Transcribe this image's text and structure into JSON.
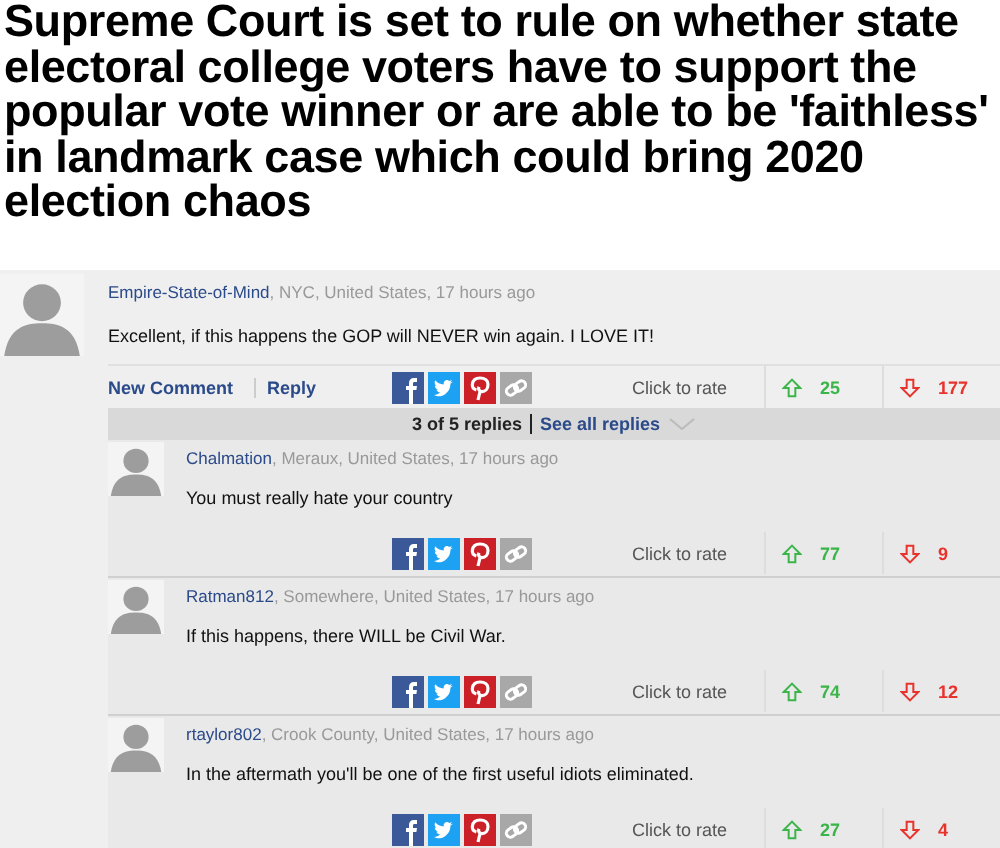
{
  "headline": "Supreme Court is set to rule on whether state electoral college voters have to support the popular vote winner or are able to be 'faithless' in landmark case which could bring 2020 election chaos",
  "comment": {
    "author": "Empire-State-of-Mind",
    "meta": ", NYC, United States, 17 hours ago",
    "body": "Excellent, if this happens the GOP will NEVER win again. I LOVE IT!",
    "actions": [
      "New Comment",
      "Reply"
    ],
    "rate_label": "Click to rate",
    "up": "25",
    "down": "177"
  },
  "replies_bar": {
    "count": "3 of 5 replies",
    "link": "See all replies"
  },
  "replies": [
    {
      "author": "Chalmation",
      "meta": ", Meraux, United States, 17 hours ago",
      "body": "You must really hate your country",
      "rate_label": "Click to rate",
      "up": "77",
      "down": "9"
    },
    {
      "author": "Ratman812",
      "meta": ", Somewhere, United States, 17 hours ago",
      "body": "If this happens, there WILL be Civil War.",
      "rate_label": "Click to rate",
      "up": "74",
      "down": "12"
    },
    {
      "author": "rtaylor802",
      "meta": ", Crook County, United States, 17 hours ago",
      "body": "In the aftermath you'll be one of the first useful idiots eliminated.",
      "rate_label": "Click to rate",
      "up": "27",
      "down": "4"
    }
  ]
}
